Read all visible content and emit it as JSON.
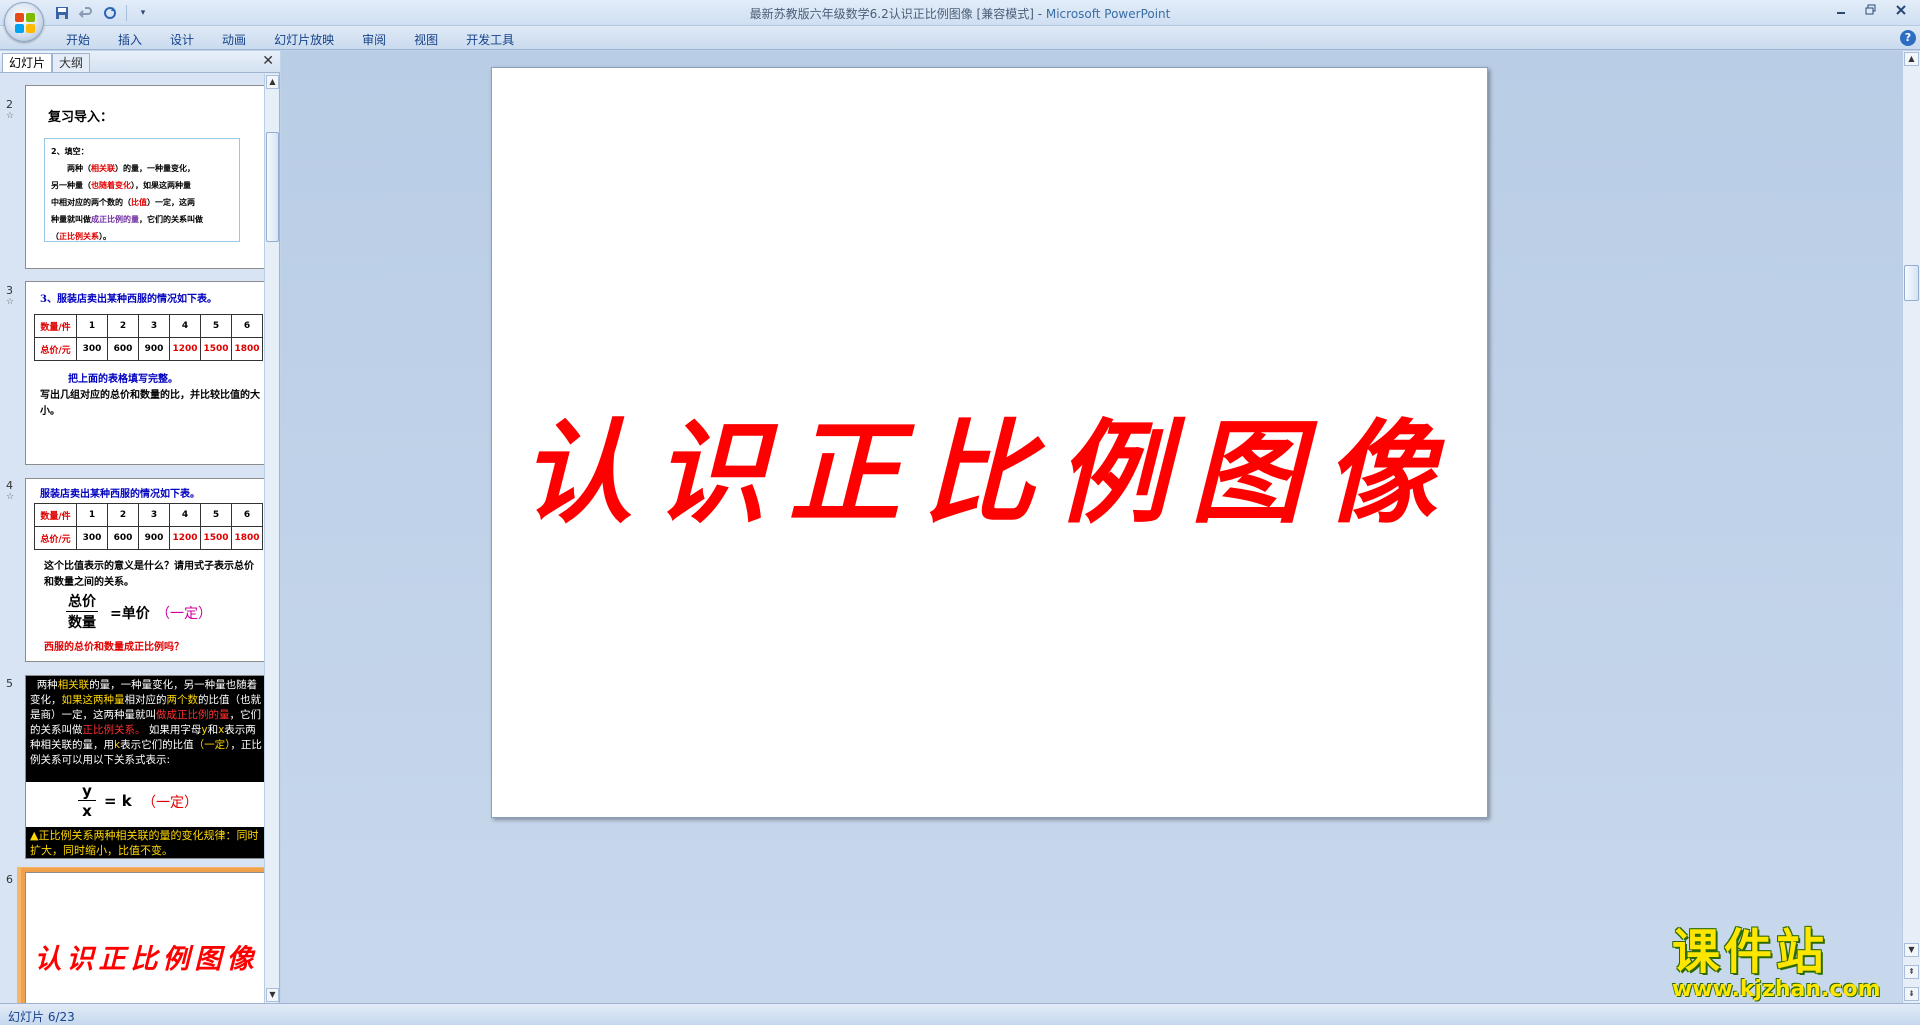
{
  "window": {
    "title": "最新苏教版六年级数学6.2认识正比例图像 [兼容模式]",
    "app_name": "Microsoft PowerPoint",
    "separator": " - "
  },
  "ribbon": {
    "tabs": [
      "开始",
      "插入",
      "设计",
      "动画",
      "幻灯片放映",
      "审阅",
      "视图",
      "开发工具"
    ]
  },
  "left_pane": {
    "tabs": [
      "幻灯片",
      "大纲"
    ],
    "slides": [
      {
        "number": "2",
        "title": "复习导入：",
        "fill": {
          "line1": "2、填空：",
          "l2a": "两种（",
          "l2b": "相关联",
          "l2c": "）的量，一种量变化，",
          "l3a": "另一种量（",
          "l3b": "也随着变化",
          "l3c": "），如果这两种量",
          "l4a": "中相对应的两个数的（",
          "l4b": "比值",
          "l4c": "）一定，这两",
          "l5a": "种量就叫做",
          "l5b": "成正比例的量",
          "l5c": "，它们的关系叫做",
          "l6a": "（",
          "l6b": "正比例关系",
          "l6c": "）。"
        }
      },
      {
        "number": "3",
        "heading": "3、服装店卖出某种西服的情况如下表。",
        "table": {
          "row1": [
            "数量/件",
            "1",
            "2",
            "3",
            "4",
            "5",
            "6"
          ],
          "row2": [
            "总价/元",
            "300",
            "600",
            "900",
            "1200",
            "1500",
            "1800"
          ]
        },
        "line1": "把上面的表格填写完整。",
        "line2": "写出几组对应的总价和数量的比，并比较比值的大小。"
      },
      {
        "number": "4",
        "heading": "服装店卖出某种西服的情况如下表。",
        "table": {
          "row1": [
            "数量/件",
            "1",
            "2",
            "3",
            "4",
            "5",
            "6"
          ],
          "row2": [
            "总价/元",
            "300",
            "600",
            "900",
            "1200",
            "1500",
            "1800"
          ]
        },
        "line1": "这个比值表示的意义是什么？请用式子表示总价和数量之间的关系。",
        "numerator": "总价",
        "denominator": "数量",
        "equals": "=单价",
        "constant": "（一定）",
        "question": "西服的总价和数量成正比例吗？"
      },
      {
        "number": "5",
        "p_a": "两种",
        "p_b": "相关联",
        "p_c": "的量，一种量变化，另一种量也随着变化，",
        "p_d": "如果这两种量",
        "p_e": "相对应的",
        "p_f": "两个数",
        "p_g": "的比值（也就是商）一定，这两种量就叫",
        "p_h": "做成正比例的量",
        "p_i": "，它们的关系叫做",
        "p_j": "正比例关系。",
        "p_k": "如果用字母",
        "p_l": "y",
        "p_m": "和",
        "p_n": "x",
        "p_o": "表示两种相关联的量，用",
        "p_p": "k",
        "p_q": "表示它们的比值",
        "p_r": "（一定）",
        "p_s": "，正比例关系可以用以下关系式表示:",
        "formula_num": "y",
        "formula_den": "x",
        "formula_eq": "= k",
        "formula_const": "（一定）",
        "note": "▲正比例关系两种相关联的量的变化规律：同时扩大，同时缩小，比值不变。"
      },
      {
        "number": "6",
        "title": "认识正比例图像"
      }
    ]
  },
  "main_slide": {
    "title": "认识正比例图像"
  },
  "watermark": {
    "cn": "课件站",
    "url": "www.kjzhan.com"
  },
  "statusbar": {
    "slide_info": "幻灯片 6/23"
  },
  "colors": {
    "title_red": "#ff0000",
    "selected_border": "#f0a14a"
  }
}
